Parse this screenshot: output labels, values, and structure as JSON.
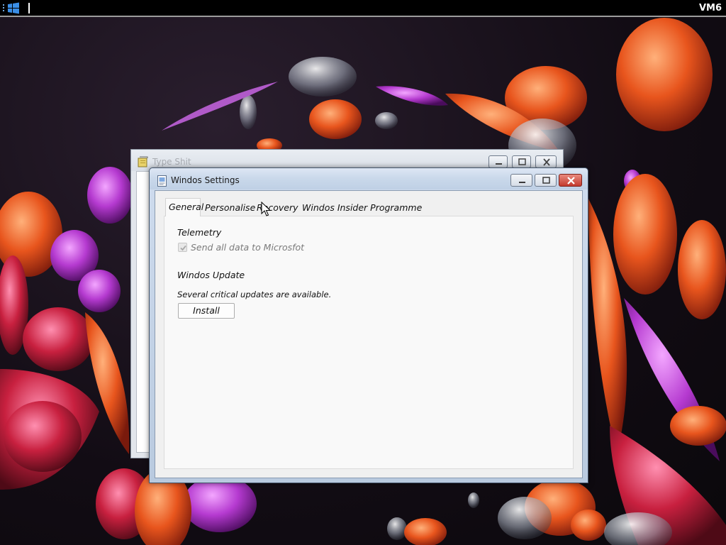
{
  "taskbar": {
    "start_icon": "windows-logo-icon",
    "vm_label": "VM6"
  },
  "background_window": {
    "title": "Type Shit",
    "icon": "notepad-icon"
  },
  "settings_window": {
    "title": "Windos Settings",
    "icon": "settings-app-icon",
    "tabs": [
      {
        "label": "General",
        "active": true
      },
      {
        "label": "Personalise",
        "active": false
      },
      {
        "label": "Recovery",
        "active": false
      },
      {
        "label": "Windos Insider Programme",
        "active": false
      }
    ],
    "general": {
      "telemetry_heading": "Telemetry",
      "telemetry_option": "Send all data to Microsfot",
      "telemetry_checked": true,
      "telemetry_disabled": true,
      "update_heading": "Windos Update",
      "update_status": "Several critical updates are available.",
      "install_label": "Install"
    }
  },
  "colors": {
    "taskbar": "#000000",
    "close_button": "#c9463d",
    "window_frame": "#bfd0e5",
    "client_background": "#f0f0f0"
  }
}
